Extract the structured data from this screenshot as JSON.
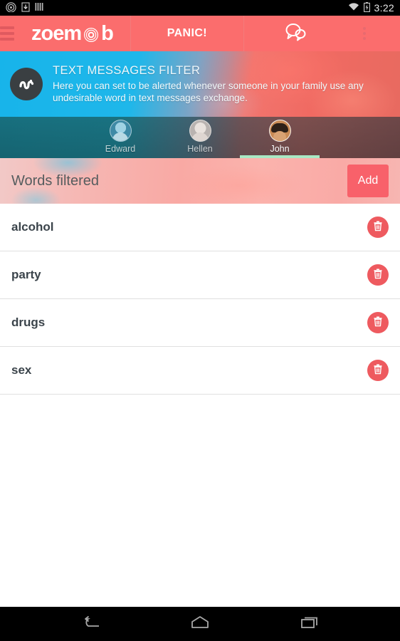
{
  "statusbar": {
    "time": "3:22",
    "left_icons": [
      "radar-icon",
      "download-icon",
      "signal-bars-icon"
    ],
    "right_icons": [
      "wifi-icon",
      "battery-charging-icon"
    ]
  },
  "appbar": {
    "menu_icon": "hamburger-menu-icon",
    "logo_text_start": "zoem",
    "logo_text_end": "b",
    "logo_mark": "target-icon",
    "panic_label": "PANIC!",
    "chat_icon": "chat-bubbles-icon",
    "overflow_icon": "overflow-menu-icon",
    "background_color": "#fb6d6d"
  },
  "banner": {
    "icon": "squiggle-message-icon",
    "title": "TEXT MESSAGES FILTER",
    "description": "Here you can set to be alerted whenever someone in your family use any undesirable word in text messages exchange."
  },
  "profile_tabs": {
    "items": [
      {
        "name": "Edward",
        "avatar": "avatar-edward",
        "selected": false
      },
      {
        "name": "Hellen",
        "avatar": "avatar-hellen",
        "selected": false
      },
      {
        "name": "John",
        "avatar": "avatar-john",
        "selected": true
      }
    ],
    "active_underline_color": "#a9e8c4"
  },
  "section": {
    "title": "Words filtered",
    "add_label": "Add",
    "add_color": "#f8616a"
  },
  "word_list": {
    "delete_icon": "trash-icon",
    "delete_color": "#ee5a5f",
    "items": [
      {
        "word": "alcohol"
      },
      {
        "word": "party"
      },
      {
        "word": "drugs"
      },
      {
        "word": "sex"
      }
    ]
  },
  "navbar": {
    "back_icon": "back-arrow-icon",
    "home_icon": "home-icon",
    "recents_icon": "recents-icon"
  }
}
